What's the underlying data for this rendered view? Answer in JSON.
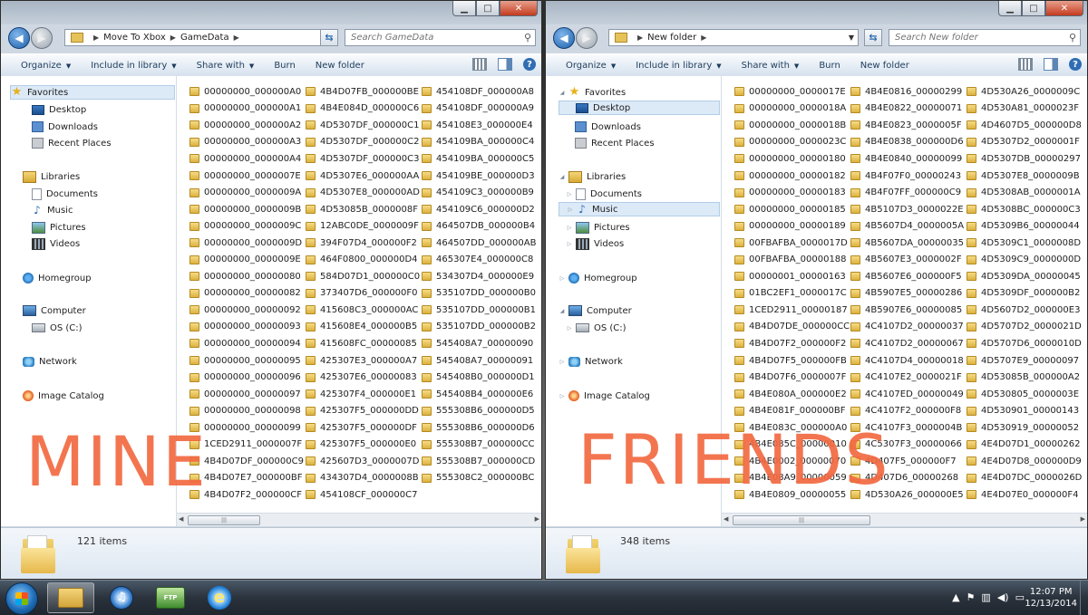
{
  "windows": [
    {
      "id": "left",
      "breadcrumb": [
        "Move To Xbox",
        "GameData"
      ],
      "search_placeholder": "Search GameData",
      "toolbar": {
        "organize": "Organize",
        "include": "Include in library",
        "share": "Share with",
        "burn": "Burn",
        "new_folder": "New folder"
      },
      "nav": {
        "favorites": "Favorites",
        "desktop": "Desktop",
        "downloads": "Downloads",
        "recent": "Recent Places",
        "libraries": "Libraries",
        "documents": "Documents",
        "music": "Music",
        "pictures": "Pictures",
        "videos": "Videos",
        "homegroup": "Homegroup",
        "computer": "Computer",
        "osc": "OS (C:)",
        "network": "Network",
        "imagecatalog": "Image Catalog"
      },
      "item_count": "121 items",
      "overlay": "MINE",
      "files": [
        "00000000_000000A0",
        "00000000_000000A1",
        "00000000_000000A2",
        "00000000_000000A3",
        "00000000_000000A4",
        "00000000_0000007E",
        "00000000_0000009A",
        "00000000_0000009B",
        "00000000_0000009C",
        "00000000_0000009D",
        "00000000_0000009E",
        "00000000_00000080",
        "00000000_00000082",
        "00000000_00000092",
        "00000000_00000093",
        "00000000_00000094",
        "00000000_00000095",
        "00000000_00000096",
        "00000000_00000097",
        "00000000_00000098",
        "00000000_00000099",
        "1CED2911_0000007F",
        "4B4D07DF_000000C9",
        "4B4D07E7_000000BF",
        "4B4D07F2_000000CF",
        "4B4D07FB_000000BE",
        "4B4E084D_000000C6",
        "4D5307DF_000000C1",
        "4D5307DF_000000C2",
        "4D5307DF_000000C3",
        "4D5307E6_000000AA",
        "4D5307E8_000000AD",
        "4D53085B_0000008F",
        "12ABC0DE_0000009F",
        "394F07D4_000000F2",
        "464F0800_000000D4",
        "584D07D1_000000C0",
        "373407D6_000000F0",
        "415608C3_000000AC",
        "415608E4_000000B5",
        "415608FC_00000085",
        "425307E3_000000A7",
        "425307E6_00000083",
        "425307F4_000000E1",
        "425307F5_000000DD",
        "425307F5_000000DF",
        "425307F5_000000E0",
        "425607D3_0000007D",
        "434307D4_0000008B",
        "454108CF_000000C7",
        "454108DF_000000A8",
        "454108DF_000000A9",
        "454108E3_000000E4",
        "454109BA_000000C4",
        "454109BA_000000C5",
        "454109BE_000000D3",
        "454109C3_000000B9",
        "454109C6_000000D2",
        "464507DB_000000B4",
        "464507DD_000000AB",
        "465307E4_000000C8",
        "534307D4_000000E9",
        "535107DD_000000B0",
        "535107DD_000000B1",
        "535107DD_000000B2",
        "545408A7_00000090",
        "545408A7_00000091",
        "545408B0_000000D1",
        "545408B4_000000E6",
        "555308B6_000000D5",
        "555308B6_000000D6",
        "555308B7_000000CC",
        "555308B7_000000CD",
        "555308C2_000000BC"
      ]
    },
    {
      "id": "right",
      "breadcrumb": [
        "New folder"
      ],
      "search_placeholder": "Search New folder",
      "toolbar": {
        "organize": "Organize",
        "include": "Include in library",
        "share": "Share with",
        "burn": "Burn",
        "new_folder": "New folder"
      },
      "nav": {
        "favorites": "Favorites",
        "desktop": "Desktop",
        "downloads": "Downloads",
        "recent": "Recent Places",
        "libraries": "Libraries",
        "documents": "Documents",
        "music": "Music",
        "pictures": "Pictures",
        "videos": "Videos",
        "homegroup": "Homegroup",
        "computer": "Computer",
        "osc": "OS (C:)",
        "network": "Network",
        "imagecatalog": "Image Catalog"
      },
      "item_count": "348 items",
      "overlay": "FRIENDS",
      "files": [
        "00000000_0000017E",
        "00000000_0000018A",
        "00000000_0000018B",
        "00000000_0000023C",
        "00000000_00000180",
        "00000000_00000182",
        "00000000_00000183",
        "00000000_00000185",
        "00000000_00000189",
        "00FBAFBA_0000017D",
        "00FBAFBA_00000188",
        "00000001_00000163",
        "01BC2EF1_0000017C",
        "1CED2911_00000187",
        "4B4D07DE_000000CC",
        "4B4D07F2_000000F2",
        "4B4D07F5_000000FB",
        "4B4D07F6_0000007F",
        "4B4E080A_000000E2",
        "4B4E081F_000000BF",
        "4B4E083C_000000A0",
        "4B4E085C_00000010",
        "4B4E0002_00000070",
        "4B4E08A9_00000059",
        "4B4E0809_00000055",
        "4B4E0816_00000299",
        "4B4E0822_00000071",
        "4B4E0823_0000005F",
        "4B4E0838_000000D6",
        "4B4E0840_00000099",
        "4B4F07F0_00000243",
        "4B4F07FF_000000C9",
        "4B5107D3_0000022E",
        "4B5607D4_0000005A",
        "4B5607DA_00000035",
        "4B5607E3_0000002F",
        "4B5607E6_000000F5",
        "4B5907E5_00000286",
        "4B5907E6_00000085",
        "4C4107D2_00000037",
        "4C4107D2_00000067",
        "4C4107D4_00000018",
        "4C4107E2_0000021F",
        "4C4107ED_00000049",
        "4C4107F2_000000F8",
        "4C4107F3_0000004B",
        "4C5307F3_00000066",
        "4D407F5_000000F7",
        "4D407D6_00000268",
        "4D530A26_000000E5",
        "4D530A26_0000009C",
        "4D530A81_0000023F",
        "4D4607D5_000000D8",
        "4D5307D2_0000001F",
        "4D5307DB_00000297",
        "4D5307E8_0000009B",
        "4D5308AB_0000001A",
        "4D5308BC_000000C3",
        "4D5309B6_00000044",
        "4D5309C1_0000008D",
        "4D5309C9_0000000D",
        "4D5309DA_00000045",
        "4D5309DF_000000B2",
        "4D5607D2_000000E3",
        "4D5707D2_0000021D",
        "4D5707D6_0000010D",
        "4D5707E9_00000097",
        "4D53085B_000000A2",
        "4D530805_0000003E",
        "4D530901_00000143",
        "4D530919_00000052",
        "4E4D07D1_00000262",
        "4E4D07D8_000000D9",
        "4E4D07DC_0000026D",
        "4E4D07E0_000000F4"
      ]
    }
  ],
  "taskbar": {
    "time": "12:07 PM",
    "date": "12/13/2014",
    "ftp_label": "FTP"
  },
  "colors": {
    "overlay": "#f26a42",
    "selection": "#dce9f7",
    "folder": "#e6c35a"
  }
}
